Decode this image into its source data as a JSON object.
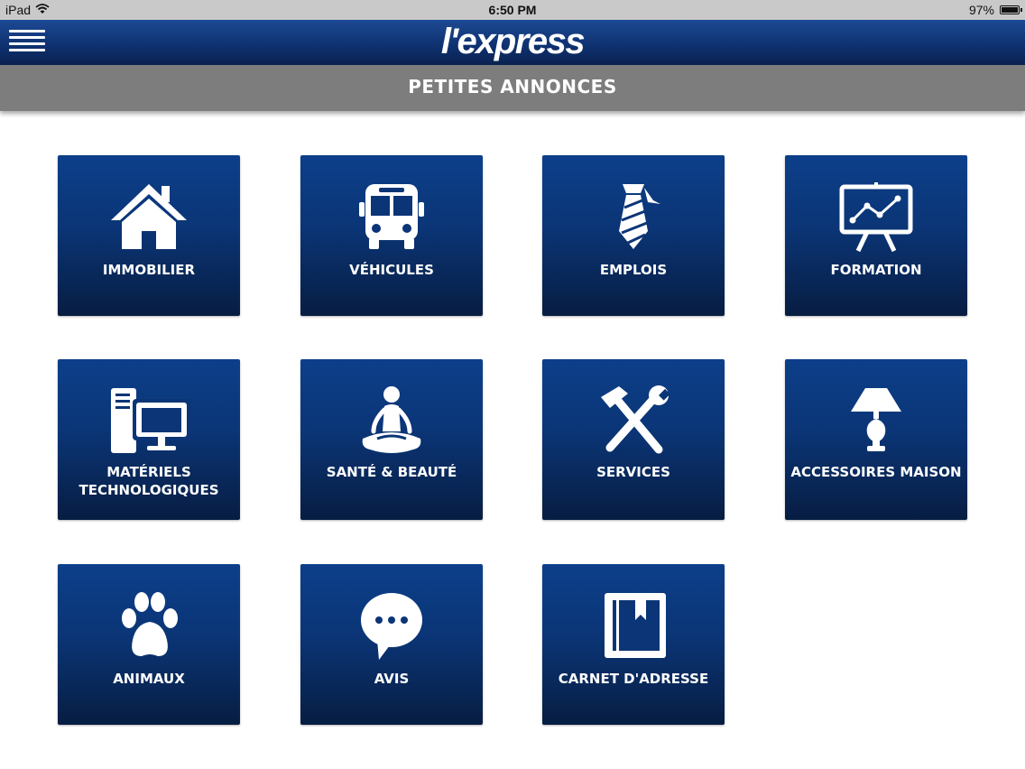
{
  "status_bar": {
    "device": "iPad",
    "time": "6:50 PM",
    "battery": "97%",
    "battery_level": 0.97,
    "icons": [
      "wifi-icon",
      "battery-icon"
    ]
  },
  "header": {
    "logo": "l'express",
    "menu_icon": "hamburger-menu-icon",
    "background": "#0f3272"
  },
  "title_bar": {
    "title": "PETITES ANNONCES",
    "background": "#7d7d7d"
  },
  "tiles": [
    {
      "label": "IMMOBILIER",
      "icon": "house-icon"
    },
    {
      "label": "VÉHICULES",
      "icon": "bus-icon"
    },
    {
      "label": "EMPLOIS",
      "icon": "tie-icon"
    },
    {
      "label": "FORMATION",
      "icon": "presentation-board-icon"
    },
    {
      "label_lines": [
        "MATÉRIELS",
        "TECHNOLOGIQUES"
      ],
      "icon": "computer-icon"
    },
    {
      "label": "SANTÉ & BEAUTÉ",
      "icon": "meditation-icon"
    },
    {
      "label": "SERVICES",
      "icon": "tools-icon"
    },
    {
      "label": "ACCESSOIRES MAISON",
      "icon": "lamp-icon"
    },
    {
      "label": "ANIMAUX",
      "icon": "paw-icon"
    },
    {
      "label": "AVIS",
      "icon": "speech-bubble-icon"
    },
    {
      "label": "CARNET D'ADRESSE",
      "icon": "address-book-icon"
    }
  ],
  "colors": {
    "tile_top": "#0c3f8a",
    "tile_bottom": "#071d42",
    "text": "#ffffff"
  }
}
